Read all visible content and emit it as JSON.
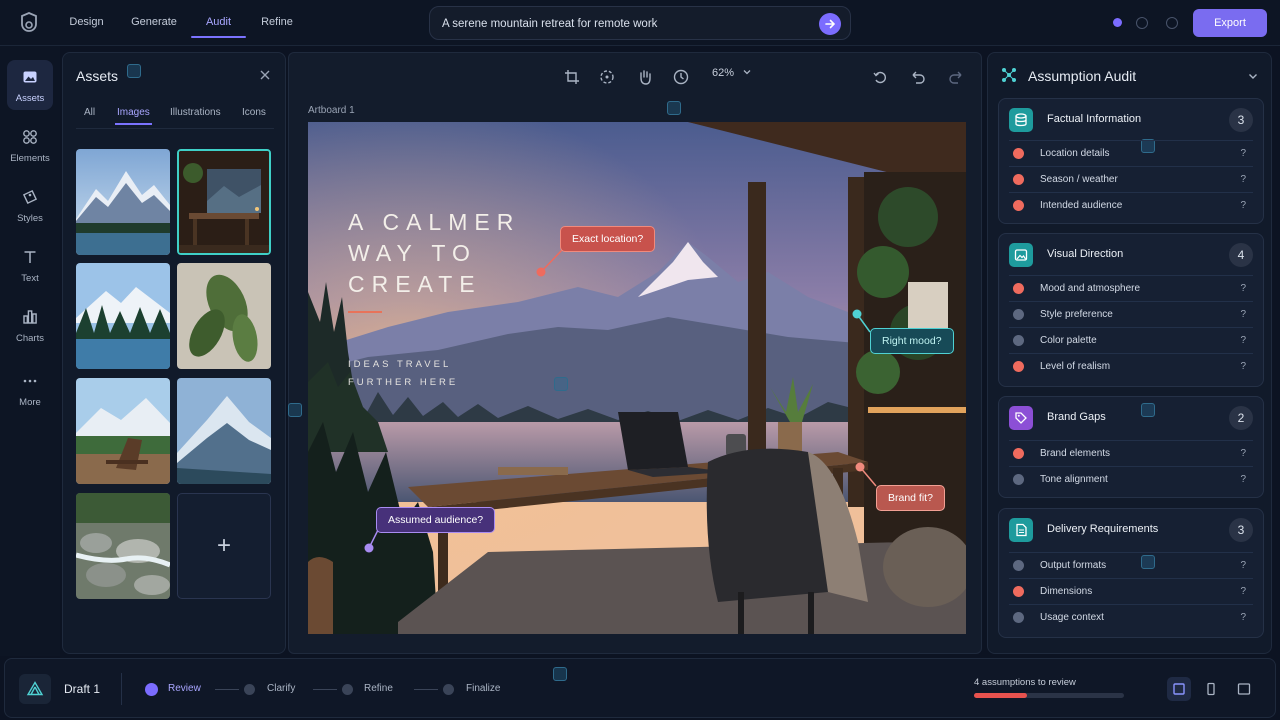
{
  "nav": {
    "tabs": [
      {
        "label": "Design"
      },
      {
        "label": "Generate"
      },
      {
        "label": "Audit"
      },
      {
        "label": "Refine"
      }
    ],
    "active": "Audit"
  },
  "prompt": {
    "value": "A serene mountain retreat for remote work"
  },
  "export_label": "Export",
  "rail": [
    {
      "label": "Assets",
      "icon": "image-icon"
    },
    {
      "label": "Elements",
      "icon": "grid-icon"
    },
    {
      "label": "Styles",
      "icon": "tag-icon"
    },
    {
      "label": "Text",
      "icon": "text-icon"
    },
    {
      "label": "Charts",
      "icon": "bar-chart-icon"
    },
    {
      "label": "More",
      "icon": "more-icon"
    }
  ],
  "assets": {
    "title": "Assets",
    "tabs": [
      {
        "label": "All"
      },
      {
        "label": "Images"
      },
      {
        "label": "Illustrations"
      },
      {
        "label": "Icons"
      }
    ],
    "active_tab": "Images",
    "add_symbol": "+"
  },
  "canvas": {
    "zoom": "62%",
    "artboard_label": "Artboard 1"
  },
  "artwork": {
    "headline": [
      "A CALMER",
      "WAY TO",
      "CREATE"
    ],
    "subline": [
      "IDEAS TRAVEL",
      "FURTHER HERE"
    ]
  },
  "annotations": [
    {
      "label": "Exact location?",
      "style": "red"
    },
    {
      "label": "Right mood?",
      "style": "teal"
    },
    {
      "label": "Assumed audience?",
      "style": "purple"
    },
    {
      "label": "Brand fit?",
      "style": "brand"
    }
  ],
  "audit": {
    "title": "Assumption Audit",
    "sections": [
      {
        "title": "Factual Information",
        "count": "3",
        "icon_color": "#1e9b9d",
        "items": [
          {
            "label": "Location details",
            "status": "red"
          },
          {
            "label": "Season / weather",
            "status": "red"
          },
          {
            "label": "Intended audience",
            "status": "red"
          }
        ]
      },
      {
        "title": "Visual Direction",
        "count": "4",
        "icon_color": "#1e9b9d",
        "items": [
          {
            "label": "Mood and atmosphere",
            "status": "red"
          },
          {
            "label": "Style preference",
            "status": "gray"
          },
          {
            "label": "Color palette",
            "status": "gray"
          },
          {
            "label": "Level of realism",
            "status": "red"
          }
        ]
      },
      {
        "title": "Brand Gaps",
        "count": "2",
        "icon_color": "#8c4fd6",
        "items": [
          {
            "label": "Brand elements",
            "status": "red"
          },
          {
            "label": "Tone alignment",
            "status": "gray"
          }
        ]
      },
      {
        "title": "Delivery Requirements",
        "count": "3",
        "icon_color": "#1e9b9d",
        "items": [
          {
            "label": "Output formats",
            "status": "gray"
          },
          {
            "label": "Dimensions",
            "status": "red"
          },
          {
            "label": "Usage context",
            "status": "gray"
          }
        ]
      }
    ],
    "question_mark": "?"
  },
  "bottom": {
    "draft": "Draft 1",
    "steps": [
      {
        "label": "Review",
        "active": true
      },
      {
        "label": "Clarify"
      },
      {
        "label": "Refine"
      },
      {
        "label": "Finalize"
      }
    ],
    "assumptions_text": "4 assumptions to review",
    "progress": 0.35
  },
  "colors": {
    "accent": "#7b6cff",
    "red": "#ef6b5e",
    "teal": "#3fd0c7",
    "gray": "#5d6880"
  }
}
